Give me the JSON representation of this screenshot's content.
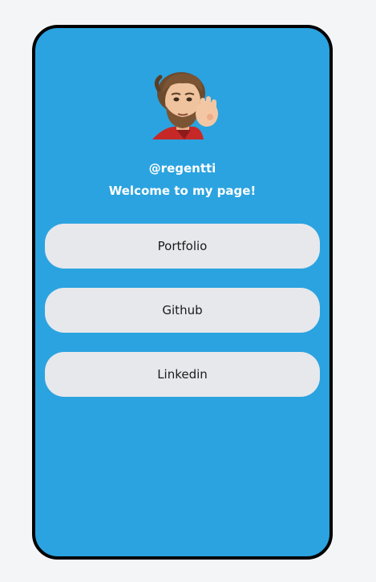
{
  "profile": {
    "handle": "@regentti",
    "welcome": "Welcome to my page!",
    "avatar_icon": "memoji-avatar-icon"
  },
  "links": [
    {
      "label": "Portfolio"
    },
    {
      "label": "Github"
    },
    {
      "label": "Linkedin"
    }
  ],
  "colors": {
    "page_background": "#f4f5f7",
    "card_background": "#2ba3e0",
    "card_border": "#000000",
    "button_background": "#e6e8ec",
    "button_text": "#1a1a1a",
    "header_text": "#ffffff"
  }
}
